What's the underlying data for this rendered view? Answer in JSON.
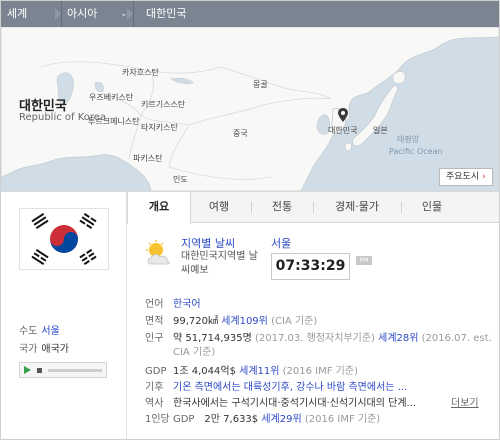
{
  "breadcrumb": {
    "items": [
      {
        "label": "세계"
      },
      {
        "label": "아시아"
      },
      {
        "label": "대한민국"
      }
    ]
  },
  "map": {
    "labels": {
      "kazakhstan": "카자흐스탄",
      "mongolia": "몽골",
      "uzbekistan": "우즈베키스탄",
      "kyrgyzstan": "키르기스스탄",
      "turkmenistan": "투르크메니스탄",
      "tajikistan": "타지키스탄",
      "china": "중국",
      "pakistan": "파키스탄",
      "india": "인도",
      "korea": "대한민국",
      "japan": "일본",
      "pacific_ko": "태평양",
      "pacific_en": "Pacific Ocean"
    },
    "major_cities_button": "주요도시"
  },
  "country": {
    "name_ko": "대한민국",
    "name_en": "Republic of Korea",
    "capital_label": "수도",
    "capital": "서울",
    "anthem_label": "국가",
    "anthem": "애국가"
  },
  "tabs": [
    {
      "label": "개요",
      "active": true
    },
    {
      "label": "여행"
    },
    {
      "label": "전통"
    },
    {
      "label": "경제·물가"
    },
    {
      "label": "인물"
    }
  ],
  "weather": {
    "title": "지역별 날씨",
    "subtitle": "대한민국지역별 날씨예보",
    "city": "서울",
    "time": "07:33:29",
    "ampm": "PM"
  },
  "facts": {
    "language": {
      "label": "언어",
      "value": "한국어"
    },
    "area": {
      "label": "면적",
      "value": "99,720㎢",
      "rank": "세계109위",
      "source": "(CIA 기준)"
    },
    "population": {
      "label": "인구",
      "value": "약 51,714,935명",
      "source": "(2017.03. 행정자치부기준)",
      "rank": "세계28위",
      "source2_line1": "(2016.07. est.",
      "source2_line2": "CIA 기준)"
    },
    "gdp": {
      "label": "GDP",
      "value": "1조 4,044억$",
      "rank": "세계11위",
      "source": "(2016 IMF 기준)"
    },
    "climate": {
      "label": "기후",
      "value": "기온 측면에서는 대륙성기후, 강수나 바람 측면에서는 ..."
    },
    "history": {
      "label": "역사",
      "value": "한국사에서는 구석기시대·중석기시대·신석기시대의 단계..."
    },
    "gdp_per_capita": {
      "label": "1인당 GDP",
      "value": "2만 7,633$",
      "rank": "세계29위",
      "source": "(2016 IMF 기준)"
    },
    "more_link": "더보기"
  }
}
